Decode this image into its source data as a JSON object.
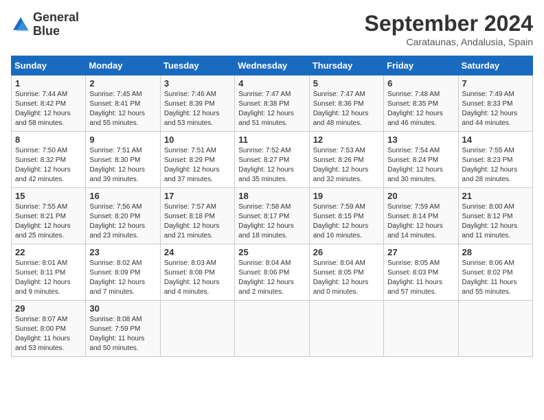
{
  "header": {
    "logo_line1": "General",
    "logo_line2": "Blue",
    "month_title": "September 2024",
    "location": "Carataunas, Andalusia, Spain"
  },
  "weekdays": [
    "Sunday",
    "Monday",
    "Tuesday",
    "Wednesday",
    "Thursday",
    "Friday",
    "Saturday"
  ],
  "weeks": [
    [
      {
        "day": "1",
        "sunrise": "7:44 AM",
        "sunset": "8:42 PM",
        "daylight": "12 hours and 58 minutes."
      },
      {
        "day": "2",
        "sunrise": "7:45 AM",
        "sunset": "8:41 PM",
        "daylight": "12 hours and 55 minutes."
      },
      {
        "day": "3",
        "sunrise": "7:46 AM",
        "sunset": "8:39 PM",
        "daylight": "12 hours and 53 minutes."
      },
      {
        "day": "4",
        "sunrise": "7:47 AM",
        "sunset": "8:38 PM",
        "daylight": "12 hours and 51 minutes."
      },
      {
        "day": "5",
        "sunrise": "7:47 AM",
        "sunset": "8:36 PM",
        "daylight": "12 hours and 48 minutes."
      },
      {
        "day": "6",
        "sunrise": "7:48 AM",
        "sunset": "8:35 PM",
        "daylight": "12 hours and 46 minutes."
      },
      {
        "day": "7",
        "sunrise": "7:49 AM",
        "sunset": "8:33 PM",
        "daylight": "12 hours and 44 minutes."
      }
    ],
    [
      {
        "day": "8",
        "sunrise": "7:50 AM",
        "sunset": "8:32 PM",
        "daylight": "12 hours and 42 minutes."
      },
      {
        "day": "9",
        "sunrise": "7:51 AM",
        "sunset": "8:30 PM",
        "daylight": "12 hours and 39 minutes."
      },
      {
        "day": "10",
        "sunrise": "7:51 AM",
        "sunset": "8:29 PM",
        "daylight": "12 hours and 37 minutes."
      },
      {
        "day": "11",
        "sunrise": "7:52 AM",
        "sunset": "8:27 PM",
        "daylight": "12 hours and 35 minutes."
      },
      {
        "day": "12",
        "sunrise": "7:53 AM",
        "sunset": "8:26 PM",
        "daylight": "12 hours and 32 minutes."
      },
      {
        "day": "13",
        "sunrise": "7:54 AM",
        "sunset": "8:24 PM",
        "daylight": "12 hours and 30 minutes."
      },
      {
        "day": "14",
        "sunrise": "7:55 AM",
        "sunset": "8:23 PM",
        "daylight": "12 hours and 28 minutes."
      }
    ],
    [
      {
        "day": "15",
        "sunrise": "7:55 AM",
        "sunset": "8:21 PM",
        "daylight": "12 hours and 25 minutes."
      },
      {
        "day": "16",
        "sunrise": "7:56 AM",
        "sunset": "8:20 PM",
        "daylight": "12 hours and 23 minutes."
      },
      {
        "day": "17",
        "sunrise": "7:57 AM",
        "sunset": "8:18 PM",
        "daylight": "12 hours and 21 minutes."
      },
      {
        "day": "18",
        "sunrise": "7:58 AM",
        "sunset": "8:17 PM",
        "daylight": "12 hours and 18 minutes."
      },
      {
        "day": "19",
        "sunrise": "7:59 AM",
        "sunset": "8:15 PM",
        "daylight": "12 hours and 16 minutes."
      },
      {
        "day": "20",
        "sunrise": "7:59 AM",
        "sunset": "8:14 PM",
        "daylight": "12 hours and 14 minutes."
      },
      {
        "day": "21",
        "sunrise": "8:00 AM",
        "sunset": "8:12 PM",
        "daylight": "12 hours and 11 minutes."
      }
    ],
    [
      {
        "day": "22",
        "sunrise": "8:01 AM",
        "sunset": "8:11 PM",
        "daylight": "12 hours and 9 minutes."
      },
      {
        "day": "23",
        "sunrise": "8:02 AM",
        "sunset": "8:09 PM",
        "daylight": "12 hours and 7 minutes."
      },
      {
        "day": "24",
        "sunrise": "8:03 AM",
        "sunset": "8:08 PM",
        "daylight": "12 hours and 4 minutes."
      },
      {
        "day": "25",
        "sunrise": "8:04 AM",
        "sunset": "8:06 PM",
        "daylight": "12 hours and 2 minutes."
      },
      {
        "day": "26",
        "sunrise": "8:04 AM",
        "sunset": "8:05 PM",
        "daylight": "12 hours and 0 minutes."
      },
      {
        "day": "27",
        "sunrise": "8:05 AM",
        "sunset": "8:03 PM",
        "daylight": "11 hours and 57 minutes."
      },
      {
        "day": "28",
        "sunrise": "8:06 AM",
        "sunset": "8:02 PM",
        "daylight": "11 hours and 55 minutes."
      }
    ],
    [
      {
        "day": "29",
        "sunrise": "8:07 AM",
        "sunset": "8:00 PM",
        "daylight": "11 hours and 53 minutes."
      },
      {
        "day": "30",
        "sunrise": "8:08 AM",
        "sunset": "7:59 PM",
        "daylight": "11 hours and 50 minutes."
      },
      null,
      null,
      null,
      null,
      null
    ]
  ]
}
